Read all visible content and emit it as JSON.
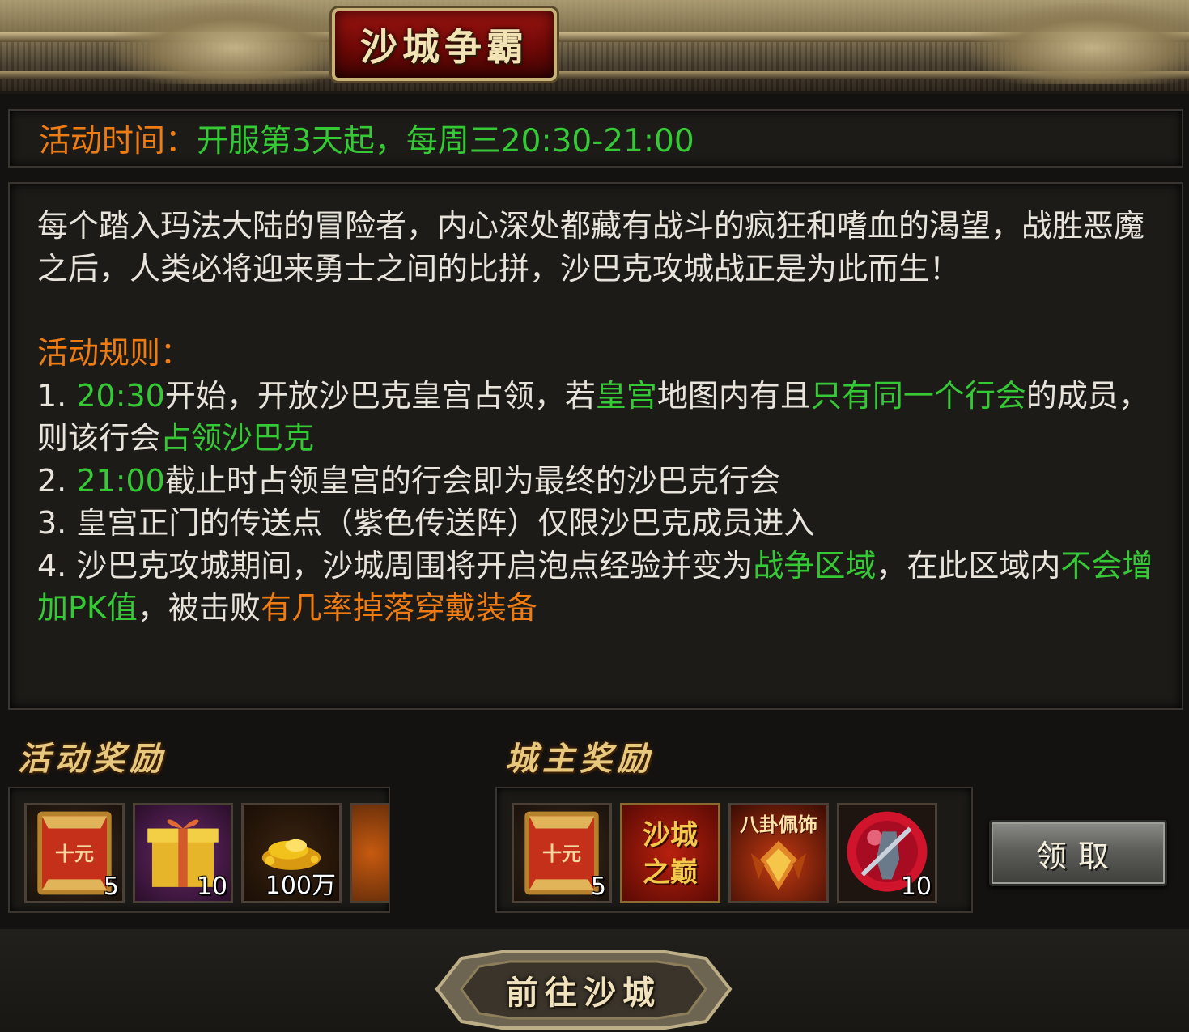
{
  "header": {
    "title": "沙城争霸"
  },
  "activity_time": {
    "label": "活动时间：",
    "value": "开服第3天起，每周三20:30-21:00"
  },
  "description": {
    "intro": "每个踏入玛法大陆的冒险者，内心深处都藏有战斗的疯狂和嗜血的渴望，战胜恶魔之后，人类必将迎来勇士之间的比拼，沙巴克攻城战正是为此而生！",
    "rules_title": "活动规则：",
    "rule1": {
      "prefix": "1. ",
      "time": "20:30",
      "text_a": "开始，开放沙巴克皇宫占领，若",
      "hl_a": "皇宫",
      "text_b": "地图内有且",
      "hl_b": "只有同一个行会",
      "text_c": "的成员，则该行会",
      "hl_c": "占领沙巴克"
    },
    "rule2": {
      "prefix": "2. ",
      "time": "21:00",
      "text": "截止时占领皇宫的行会即为最终的沙巴克行会"
    },
    "rule3": {
      "text": "3.  皇宫正门的传送点（紫色传送阵）仅限沙巴克成员进入"
    },
    "rule4": {
      "text_a": "4.  沙巴克攻城期间，沙城周围将开启泡点经验并变为",
      "hl_a": "战争区域",
      "text_b": "，在此区域内",
      "hl_b": "不会增加PK值",
      "text_c": "，被击败",
      "hl_c": "有几率掉落穿戴装备"
    }
  },
  "activity_rewards": {
    "title": "活动奖励",
    "items": [
      {
        "icon": "ten-yuan-card-icon",
        "label": "十元",
        "count": "5"
      },
      {
        "icon": "gift-box-icon",
        "count": "10"
      },
      {
        "icon": "gold-coins-icon",
        "count": "100万"
      }
    ]
  },
  "lord_rewards": {
    "title": "城主奖励",
    "items": [
      {
        "icon": "ten-yuan-card-icon",
        "label": "十元",
        "count": "5"
      },
      {
        "icon": "sand-city-peak-title-icon",
        "label": "沙城之巅"
      },
      {
        "icon": "bagua-pendant-icon",
        "label": "八卦佩饰"
      },
      {
        "icon": "warrior-orb-icon",
        "count": "10"
      }
    ]
  },
  "buttons": {
    "claim": "领取",
    "goto": "前往沙城"
  },
  "colors": {
    "orange": "#ee7c13",
    "green": "#36c936",
    "text": "#e8e4dc",
    "gold_title": "#e7c87c"
  }
}
